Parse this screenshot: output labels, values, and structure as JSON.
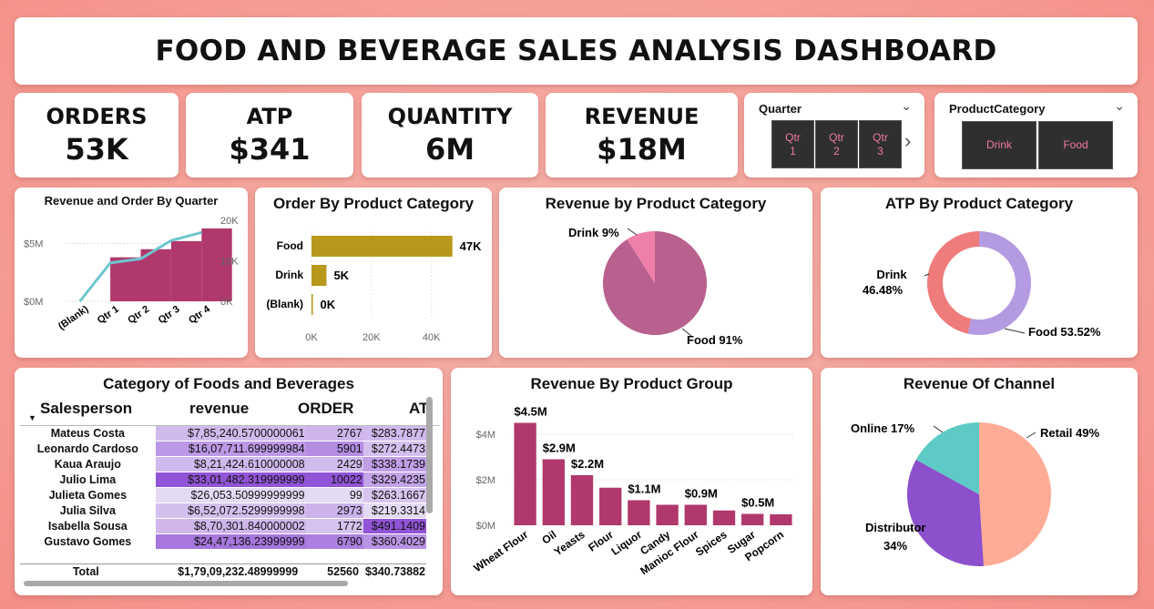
{
  "title": "FOOD AND BEVERAGE SALES ANALYSIS DASHBOARD",
  "kpis": [
    {
      "label": "ORDERS",
      "value": "53K"
    },
    {
      "label": "ATP",
      "value": "$341"
    },
    {
      "label": "QUANTITY",
      "value": "6M"
    },
    {
      "label": "REVENUE",
      "value": "$18M"
    }
  ],
  "quarter_slicer": {
    "title": "Quarter",
    "options": [
      [
        "Qtr",
        "1"
      ],
      [
        "Qtr",
        "2"
      ],
      [
        "Qtr",
        "3"
      ]
    ],
    "more": "›"
  },
  "category_slicer": {
    "title": "ProductCategory",
    "options": [
      "Drink",
      "Food"
    ]
  },
  "colors": {
    "magenta": "#b0386c",
    "mustard": "#b8981a",
    "teal": "#6ec6cf",
    "pie_food": "#b8608e",
    "pie_drink": "#ee7fa8",
    "donut_food": "#b49ae0",
    "donut_drink": "#ef7b7b",
    "retail": "#ffac97",
    "distributor": "#8c50cc",
    "online": "#5ecac6"
  },
  "charts": {
    "rev_order_quarter": {
      "title": "Revenue and Order By Quarter",
      "left_ticks": [
        "$5M",
        "$0M"
      ],
      "right_ticks": [
        "20K",
        "10K",
        "0K"
      ],
      "chart_data": {
        "type": "area",
        "categories": [
          "(Blank)",
          "Qtr 1",
          "Qtr 2",
          "Qtr 3",
          "Qtr 4"
        ],
        "series": [
          {
            "values": [
              0,
              3.8,
              4.5,
              5.2,
              6.3
            ],
            "unit": "M"
          },
          {
            "values": [
              0,
              9.5,
              10.5,
              15,
              17
            ],
            "unit": "K"
          }
        ],
        "ylim_left": [
          0,
          7
        ],
        "ylim_right": [
          0,
          20
        ]
      }
    },
    "order_by_category": {
      "title": "Order By Product Category",
      "x_ticks": [
        "0K",
        "20K",
        "40K"
      ],
      "chart_data": {
        "type": "bar",
        "categories": [
          "Food",
          "Drink",
          "(Blank)"
        ],
        "values": [
          47,
          5,
          0
        ],
        "labels": [
          "47K",
          "5K",
          "0K"
        ],
        "xlim": [
          0,
          55
        ]
      }
    },
    "revenue_by_category": {
      "title": "Revenue by Product Category",
      "chart_data": {
        "type": "pie",
        "categories": [
          "Food",
          "Drink"
        ],
        "values": [
          91,
          9
        ],
        "labels": [
          "Food 91%",
          "Drink 9%"
        ]
      }
    },
    "atp_by_category": {
      "title": "ATP By Product Category",
      "chart_data": {
        "type": "pie",
        "categories": [
          "Food",
          "Drink"
        ],
        "values": [
          53.52,
          46.48
        ],
        "labels": [
          "Food 53.52%",
          "Drink",
          "46.48%"
        ]
      }
    },
    "revenue_by_group": {
      "title": "Revenue By Product Group",
      "y_ticks": [
        "$4M",
        "$2M",
        "$0M"
      ],
      "chart_data": {
        "type": "bar",
        "categories": [
          "Wheat Flour",
          "Oil",
          "Yeasts",
          "Flour",
          "Liquor",
          "Candy",
          "Manioc Flour",
          "Spices",
          "Sugar",
          "Popcorn"
        ],
        "values": [
          4.5,
          2.9,
          2.2,
          1.65,
          1.1,
          0.9,
          0.9,
          0.65,
          0.5,
          0.48
        ],
        "data_labels": [
          "$4.5M",
          "$2.9M",
          "$2.2M",
          "",
          "$1.1M",
          "",
          "$0.9M",
          "",
          "$0.5M",
          ""
        ],
        "ylim": [
          0,
          5
        ]
      }
    },
    "revenue_of_channel": {
      "title": "Revenue Of Channel",
      "chart_data": {
        "type": "pie",
        "categories": [
          "Retail",
          "Distributor",
          "Online"
        ],
        "values": [
          49,
          34,
          17
        ],
        "labels": [
          "Retail 49%",
          "Distributor",
          "34%",
          "Online 17%"
        ]
      }
    }
  },
  "table": {
    "title": "Category of Foods and Beverages",
    "headers": [
      "Salesperson",
      "revenue",
      "ORDER",
      "AT"
    ],
    "rows": [
      [
        "Mateus Costa",
        "$7,85,240.5700000061",
        "2767",
        "$283.7877"
      ],
      [
        "Leonardo Cardoso",
        "$16,07,711.699999984",
        "5901",
        "$272.4473"
      ],
      [
        "Kaua Araujo",
        "$8,21,424.610000008",
        "2429",
        "$338.1739"
      ],
      [
        "Julio Lima",
        "$33,01,482.319999999",
        "10022",
        "$329.4235"
      ],
      [
        "Julieta Gomes",
        "$26,053.50999999999",
        "99",
        "$263.1667"
      ],
      [
        "Julia Silva",
        "$6,52,072.5299999998",
        "2973",
        "$219.3314"
      ],
      [
        "Isabella Sousa",
        "$8,70,301.840000002",
        "1772",
        "$491.1409"
      ],
      [
        "Gustavo Gomes",
        "$24,47,136.23999999",
        "6790",
        "$360.4029"
      ]
    ],
    "total": [
      "Total",
      "$1,79,09,232.48999999",
      "52560",
      "$340.73882"
    ]
  }
}
